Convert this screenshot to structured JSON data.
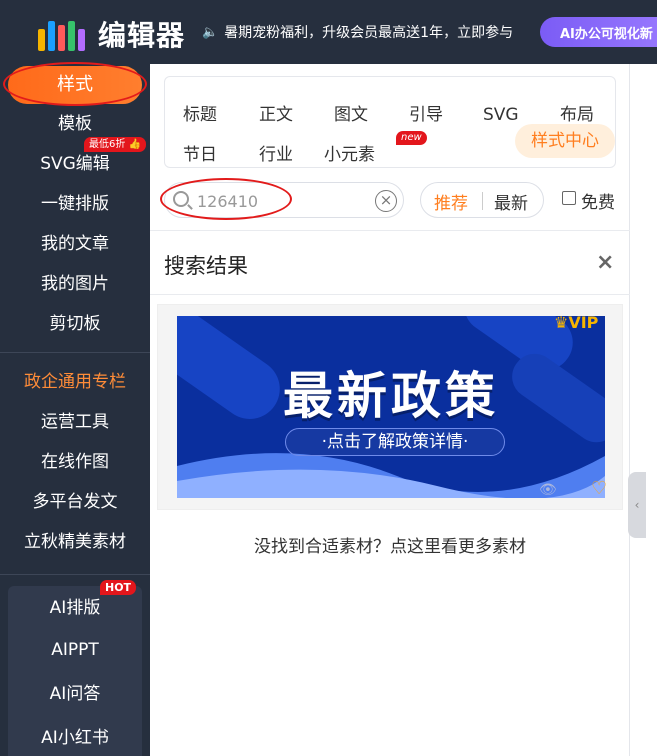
{
  "header": {
    "brand_name": "编辑器",
    "announcement": "暑期宠粉福利，升级会员最高送1年，立即参与",
    "ai_button": "AI办公可视化新"
  },
  "sidebar": {
    "items": [
      {
        "label": "样式"
      },
      {
        "label": "模板"
      },
      {
        "label": "SVG编辑"
      },
      {
        "label": "一键排版"
      },
      {
        "label": "我的文章"
      },
      {
        "label": "我的图片"
      },
      {
        "label": "剪切板"
      },
      {
        "label": "政企通用专栏"
      },
      {
        "label": "运营工具"
      },
      {
        "label": "在线作图"
      },
      {
        "label": "多平台发文"
      },
      {
        "label": "立秋精美素材"
      }
    ],
    "discount_badge": "最低6折",
    "ai_items": [
      {
        "label": "AI排版"
      },
      {
        "label": "AIPPT"
      },
      {
        "label": "AI问答"
      },
      {
        "label": "AI小红书"
      }
    ],
    "hot_badge": "HOT"
  },
  "categories": {
    "row1": [
      "标题",
      "正文",
      "图文",
      "引导",
      "SVG",
      "布局"
    ],
    "row2": [
      "节日",
      "行业",
      "小元素"
    ],
    "new_badge": "new",
    "style_center": "样式中心"
  },
  "search": {
    "value": "126410",
    "sort_recommend": "推荐",
    "sort_latest": "最新",
    "free_label": "免费"
  },
  "results": {
    "title": "搜索结果",
    "close": "×",
    "card": {
      "headline": "最新政策",
      "subline": "·点击了解政策详情·",
      "vip": "VIP"
    },
    "more_link": "没找到合适素材？点这里看更多素材"
  },
  "colors": {
    "sidebar_bg": "#262f3e",
    "accent_orange": "#ff7e1f",
    "badge_red": "#e3161c",
    "banner_blue": "#0a2f9e"
  }
}
